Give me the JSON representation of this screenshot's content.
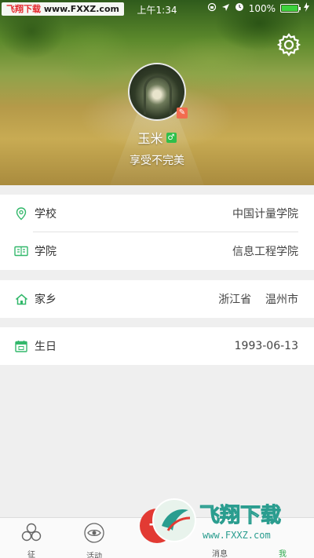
{
  "status_bar": {
    "watermark_red": "飞翔下载",
    "watermark_black": "www.FXXZ.com",
    "time": "上午1:34",
    "battery": "100%"
  },
  "profile": {
    "name": "玉米",
    "gender_symbol": "♂",
    "motto": "享受不完美"
  },
  "info": {
    "school": {
      "label": "学校",
      "value": "中国计量学院"
    },
    "college": {
      "label": "学院",
      "value": "信息工程学院"
    },
    "hometown": {
      "label": "家乡",
      "value": "浙江省    温州市"
    },
    "birthday": {
      "label": "生日",
      "value": "1993-06-13"
    }
  },
  "tabbar": {
    "tabs": [
      {
        "label": "征"
      },
      {
        "label": "活动"
      },
      {
        "label": "消息"
      },
      {
        "label": "我"
      }
    ],
    "fab_symbol": "+"
  },
  "overlay_logo": {
    "title": "飞翔下载",
    "url": "www.FXXZ.com"
  },
  "colors": {
    "accent_green": "#2ba84a",
    "icon_green": "#33b86b",
    "fab_red": "#e23a33"
  }
}
